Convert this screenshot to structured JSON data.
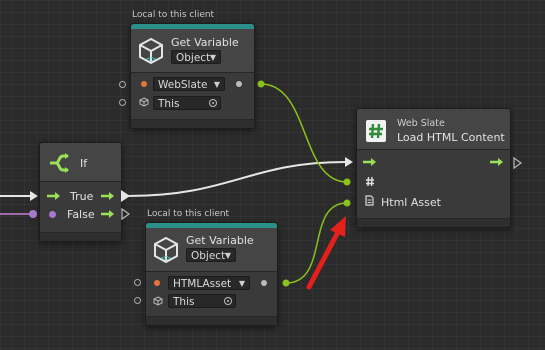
{
  "node_get_var_1": {
    "local_label": "Local to this client",
    "title": "Get Variable",
    "type_select": "Object",
    "variable_select": "WebSlate",
    "target_value": "This"
  },
  "node_get_var_2": {
    "local_label": "Local to this client",
    "title": "Get Variable",
    "type_select": "Object",
    "variable_select": "HTMLAsset",
    "target_value": "This"
  },
  "node_if": {
    "title": "If",
    "true_label": "True",
    "false_label": "False"
  },
  "node_load_html": {
    "subtitle": "Web Slate",
    "title": "Load HTML Content",
    "param_label": "Html Asset"
  },
  "colors": {
    "flow": "#9be05a",
    "object_wire": "#8bc21c",
    "header_stripe": "#2b8f8a",
    "annotation_arrow": "#e3201b"
  }
}
